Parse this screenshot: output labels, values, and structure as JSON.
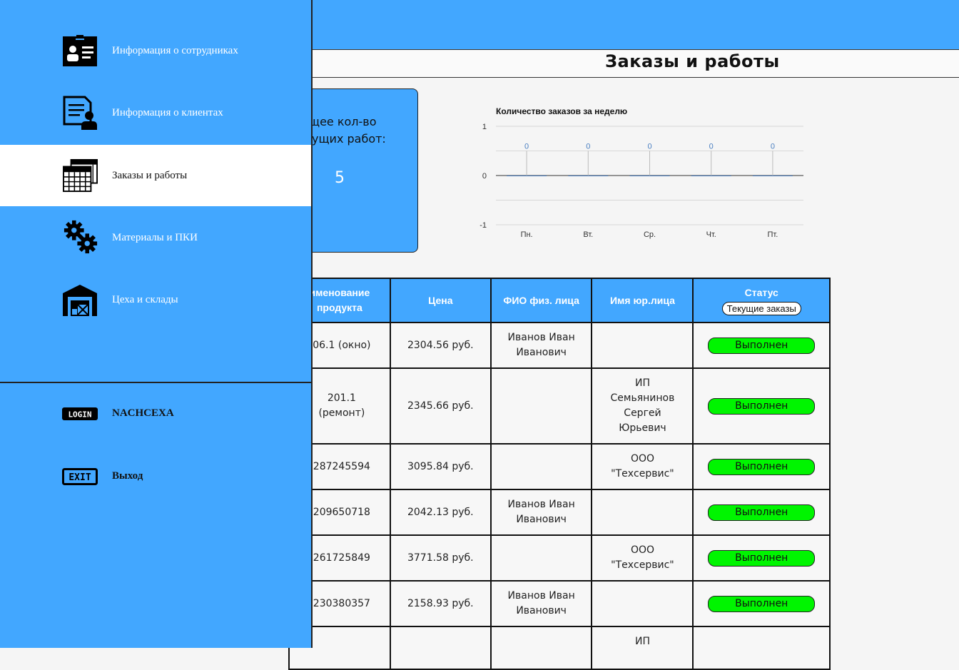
{
  "header": {
    "title": "Заказы и работы"
  },
  "summary": {
    "line1": "щее кол-во",
    "line2": "ущих работ:",
    "count": "5"
  },
  "chart_data": {
    "type": "bar",
    "title": "Количество заказов за неделю",
    "categories": [
      "Пн.",
      "Вт.",
      "Ср.",
      "Чт.",
      "Пт."
    ],
    "values": [
      0,
      0,
      0,
      0,
      0
    ],
    "data_labels": [
      "0",
      "0",
      "0",
      "0",
      "0"
    ],
    "ylim": [
      -1,
      1
    ],
    "yticks": [
      1,
      0,
      -1
    ],
    "ytick_labels": [
      "1",
      "0",
      "-1"
    ],
    "grid": true,
    "bar_color": "#4a7fc1"
  },
  "table": {
    "headers": {
      "product": "именование продукта",
      "price": "Цена",
      "person": "ФИО физ. лица",
      "company": "Имя юр.лица",
      "status": "Статус",
      "status_filter": "Текущие заказы"
    },
    "rows": [
      {
        "product": "06.1 (окно)",
        "price": "2304.56 руб.",
        "person": "Иванов Иван Иванович",
        "company": "",
        "status": "Выполнен"
      },
      {
        "product": "201.1 (ремонт)",
        "price": "2345.66 руб.",
        "person": "",
        "company": "ИП Семьянинов Сергей Юрьевич",
        "status": "Выполнен"
      },
      {
        "product": "287245594",
        "price": "3095.84 руб.",
        "person": "",
        "company": "ООО \"Техсервис\"",
        "status": "Выполнен"
      },
      {
        "product": "209650718",
        "price": "2042.13 руб.",
        "person": "Иванов Иван Иванович",
        "company": "",
        "status": "Выполнен"
      },
      {
        "product": "261725849",
        "price": "3771.58 руб.",
        "person": "",
        "company": "ООО \"Техсервис\"",
        "status": "Выполнен"
      },
      {
        "product": "230380357",
        "price": "2158.93 руб.",
        "person": "Иванов Иван Иванович",
        "company": "",
        "status": "Выполнен"
      },
      {
        "product": "",
        "price": "",
        "person": "",
        "company": "ИП",
        "status": ""
      }
    ]
  },
  "sidebar": {
    "items": [
      {
        "label": "Информация о сотрудниках",
        "icon": "employee-card-icon"
      },
      {
        "label": "Информация о клиентах",
        "icon": "client-document-icon"
      },
      {
        "label": "Заказы и работы",
        "icon": "calendar-grid-icon",
        "active": true
      },
      {
        "label": "Материалы и ПКИ",
        "icon": "gears-icon"
      },
      {
        "label": "Цеха и склады",
        "icon": "warehouse-icon"
      }
    ],
    "account": {
      "login_icon_text": "LOGIN",
      "username": "NACHCEXA",
      "exit_icon_text": "EXIT",
      "exit_label": "Выход"
    }
  },
  "colors": {
    "accent": "#42a7ff",
    "status_done": "#00f500"
  }
}
